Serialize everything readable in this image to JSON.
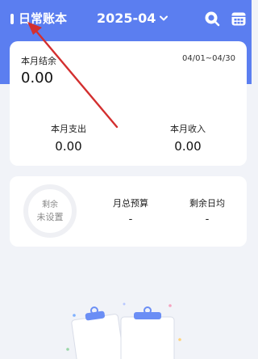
{
  "header": {
    "book_name": "日常账本",
    "month": "2025-04"
  },
  "summary": {
    "balance_label": "本月结余",
    "balance_value": "0.00",
    "date_range": "04/01~04/30",
    "expense_label": "本月支出",
    "expense_value": "0.00",
    "income_label": "本月收入",
    "income_value": "0.00"
  },
  "budget": {
    "ring_line1": "剩余",
    "ring_line2": "未设置",
    "total_label": "月总预算",
    "total_value": "-",
    "daily_label": "剩余日均",
    "daily_value": "-"
  },
  "colors": {
    "accent": "#5b7ef0",
    "annotation_arrow": "#d32f2f"
  },
  "icons": [
    "search-icon",
    "calendar-icon",
    "chevron-down-icon",
    "empty-clipboard-illustration"
  ]
}
